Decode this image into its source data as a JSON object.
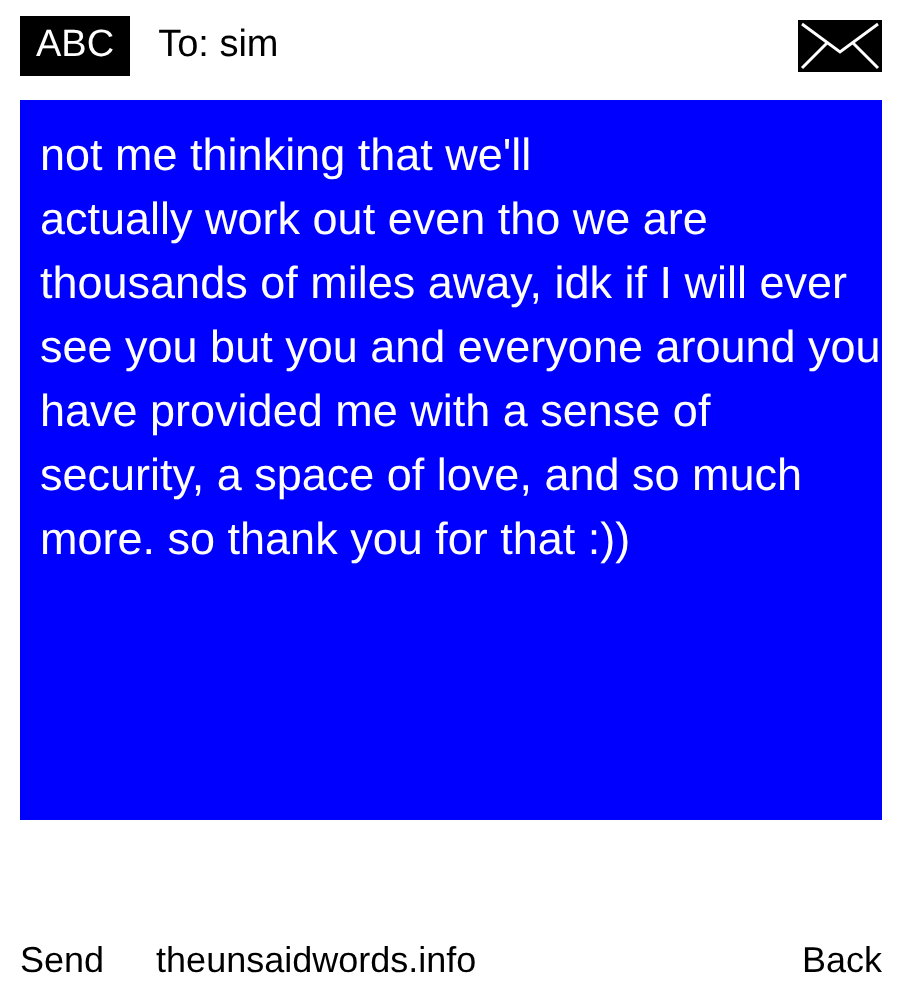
{
  "header": {
    "badge": "ABC",
    "recipient": "To: sim"
  },
  "message": {
    "text": "not me thinking that we'll\nactually work out even tho we are thousands of miles away, idk if I will ever see you but you and everyone around you have provided me with a sense of security, a space of love, and so much more. so thank you for that :))"
  },
  "footer": {
    "left": "Send",
    "center": "theunsaidwords.info",
    "right": "Back"
  }
}
